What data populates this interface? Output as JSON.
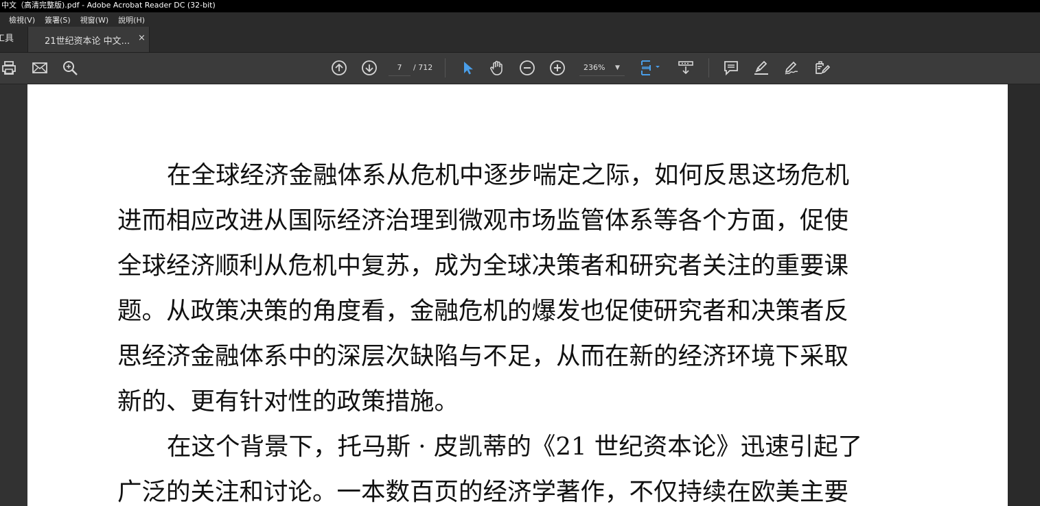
{
  "window": {
    "title": "中文（高清完整版).pdf - Adobe Acrobat Reader DC (32-bit)"
  },
  "menu": {
    "items": [
      "檢視(V)",
      "簽署(S)",
      "視窗(W)",
      "說明(H)"
    ]
  },
  "tabs": {
    "tools_label": "工具",
    "document_label": "21世纪资本论 中文...",
    "close_glyph": "×"
  },
  "toolbar": {
    "page_current": "7",
    "page_total": "/ 712",
    "zoom": "236%",
    "icons": [
      "print-icon",
      "email-icon",
      "search-icon",
      "prev-page-icon",
      "next-page-icon",
      "select-cursor-icon",
      "hand-icon",
      "zoom-out-icon",
      "zoom-in-icon",
      "fit-page-icon",
      "scroll-mode-icon",
      "comment-icon",
      "highlight-icon",
      "sign-icon",
      "fill-sign-icon"
    ],
    "accent_color": "#4a9ee8"
  },
  "document": {
    "paragraph1": [
      "在全球经济金融体系从危机中逐步喘定之际，如何反思这场危机",
      "进而相应改进从国际经济治理到微观市场监管体系等各个方面，促使",
      "全球经济顺利从危机中复苏，成为全球决策者和研究者关注的重要课",
      "题。从政策决策的角度看，金融危机的爆发也促使研究者和决策者反",
      "思经济金融体系中的深层次缺陷与不足，从而在新的经济环境下采取",
      "新的、更有针对性的政策措施。"
    ],
    "paragraph2": [
      "在这个背景下，托马斯 · 皮凯蒂的《21 世纪资本论》迅速引起了",
      "广泛的关注和讨论。一本数百页的经济学著作，不仅持续在欧美主要"
    ]
  }
}
